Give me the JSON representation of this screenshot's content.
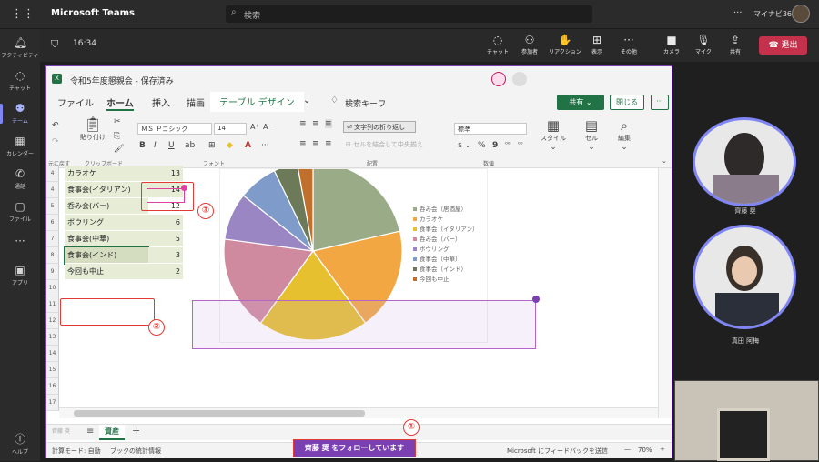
{
  "teams": {
    "app_title": "Microsoft Teams",
    "search_placeholder": "検索",
    "more": "···",
    "org": "マイナビ365"
  },
  "rail": [
    {
      "label": "アクティビティ",
      "icon": "bell-icon"
    },
    {
      "label": "チャット",
      "icon": "chat-icon"
    },
    {
      "label": "チーム",
      "icon": "teams-icon"
    },
    {
      "label": "カレンダー",
      "icon": "calendar-icon"
    },
    {
      "label": "通話",
      "icon": "phone-icon"
    },
    {
      "label": "ファイル",
      "icon": "file-icon"
    },
    {
      "label": "···",
      "icon": "more-icon"
    },
    {
      "label": "アプリ",
      "icon": "apps-icon"
    },
    {
      "label": "ヘルプ",
      "icon": "help-icon"
    }
  ],
  "meeting": {
    "timer": "16:34",
    "buttons": [
      {
        "label": "チャット",
        "icon": "chat-icon"
      },
      {
        "label": "参加者",
        "icon": "people-icon"
      },
      {
        "label": "リアクション",
        "icon": "reaction-icon"
      },
      {
        "label": "表示",
        "icon": "grid-icon"
      },
      {
        "label": "その他",
        "icon": "more-icon"
      },
      {
        "label": "カメラ",
        "icon": "camera-icon"
      },
      {
        "label": "マイク",
        "icon": "mic-icon"
      },
      {
        "label": "共有",
        "icon": "share-icon"
      }
    ],
    "leave_label": "退出",
    "leave_color": "#c4314b"
  },
  "excel": {
    "filename": "令和5年度懇親会 - 保存済み",
    "tabs": [
      "ファイル",
      "ホーム",
      "挿入",
      "描画",
      "テーブル デザイン"
    ],
    "active_tab": "ホーム",
    "search_label": "検索キーワ",
    "share_label": "共有",
    "close_label": "閉じる",
    "ribbon": {
      "undo_label": "元に戻す",
      "paste_label": "貼り付け",
      "clipboard_label": "クリップボード",
      "font_name": "ＭＳ Ｐゴシック",
      "font_size": "14",
      "font_label": "フォント",
      "wrap_label": "文字列の折り返し",
      "merge_label": "セルを結合して中央揃え",
      "align_label": "配置",
      "number_format": "標準",
      "number_label": "数値",
      "style_label": "スタイル",
      "cell_label": "セル",
      "edit_label": "編集"
    },
    "rows": [
      {
        "num": "4",
        "a": "カラオケ",
        "b": "13"
      },
      {
        "num": "4",
        "a": "食事会(イタリアン)",
        "b": "14"
      },
      {
        "num": "5",
        "a": "呑み会(バー)",
        "b": "12"
      },
      {
        "num": "6",
        "a": "ボウリング",
        "b": "6"
      },
      {
        "num": "7",
        "a": "食事会(中華)",
        "b": "5"
      },
      {
        "num": "8",
        "a": "食事会(インド)",
        "b": "3"
      },
      {
        "num": "9",
        "a": "今回も中止",
        "b": "2"
      },
      {
        "num": "10",
        "a": "",
        "b": ""
      },
      {
        "num": "11",
        "a": "",
        "b": ""
      },
      {
        "num": "12",
        "a": "",
        "b": ""
      },
      {
        "num": "13",
        "a": "",
        "b": ""
      },
      {
        "num": "14",
        "a": "",
        "b": ""
      },
      {
        "num": "15",
        "a": "",
        "b": ""
      },
      {
        "num": "16",
        "a": "",
        "b": ""
      },
      {
        "num": "17",
        "a": "",
        "b": ""
      }
    ],
    "sheet_tab": "資産",
    "sheet_left_text": "齊藤 奨",
    "status_mode": "計算モード: 自動",
    "status_stats": "ブックの統計情報",
    "status_feedback": "Microsoft にフィードバックを送信",
    "zoom": "70%",
    "follow_label": "齊藤 奨 をフォローしています"
  },
  "chart_data": {
    "type": "pie",
    "categories": [
      "呑み会（居酒屋）",
      "カラオケ",
      "食事会（イタリアン）",
      "呑み会（バー）",
      "ボウリング",
      "食事会（中華）",
      "食事会（インド）",
      "今回も中止"
    ],
    "values": [
      15,
      13,
      14,
      12,
      6,
      5,
      3,
      2
    ],
    "colors": [
      "#9aab88",
      "#f2a742",
      "#e6c02f",
      "#d08aa0",
      "#9b86c4",
      "#7e9bc9",
      "#6c7a5a",
      "#c0702a"
    ],
    "legend": "right"
  },
  "participants": [
    {
      "name": "齊藤 奨"
    },
    {
      "name": "真田 阿梅"
    }
  ],
  "callouts": [
    "①",
    "②",
    "③"
  ]
}
